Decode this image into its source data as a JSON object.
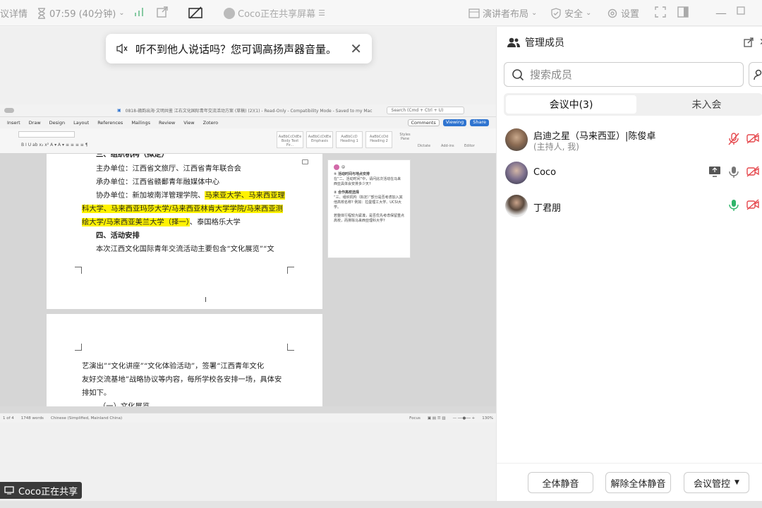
{
  "topbar": {
    "meeting_details": "议详情",
    "duration": "07:59 (40分钟)",
    "sharing_status": "Coco正在共享屏幕",
    "speaker_layout": "演讲者布局",
    "security": "安全",
    "settings": "设置"
  },
  "toast": {
    "message": "听不到他人说话吗？您可调高扬声器音量。",
    "close": "✕"
  },
  "word": {
    "filename": "0818-赣韵出海·文明共鉴 江右文化国际青年交流活动方案 (草稿) (2)(1) - Read-Only - Compatibility Mode - Saved to my Mac",
    "search": "Search (Cmd + Ctrl + U)",
    "menu": [
      "Insert",
      "Draw",
      "Design",
      "Layout",
      "References",
      "Mailings",
      "Review",
      "View",
      "Zotero"
    ],
    "comments_btn": "Comments",
    "viewing_btn": "Viewing",
    "share_btn": "Share",
    "styles": [
      "AaBbCcDdEe",
      "AaBbCcDdEe",
      "AaBbCcD",
      "AaBbCcDd"
    ],
    "style_labels": [
      "Body Text Fir...",
      "Emphasis",
      "Heading 1",
      "Heading 2"
    ],
    "ribbon_right": [
      "Styles Pane",
      "Dictate",
      "Add-ins",
      "Editor"
    ],
    "page1": {
      "heading": "三、组织机构（拟定）",
      "host": "主办单位：江西省文旅厅、江西省青年联合会",
      "organizer": "承办单位：江西省赣鄱青年融媒体中心",
      "co_prefix": "协办单位：新加坡南洋管理学院、",
      "co_hl1": "马来亚大学、马来西亚理",
      "co_hl2": "科大学、马来西亚玛莎大学/马来西亚林肯大学学院/马来西亚测",
      "co_hl3": "绘大学/马来西亚美兰大学（择一）",
      "co_end": "、泰国格乐大学",
      "section4": "四、活动安排",
      "intro": "本次江西文化国际青年交流活动主要包含“文化展览”“文"
    },
    "page2": {
      "line1": "艺演出”“文化讲座”“文化体验活动”，签署“江西青年文化",
      "line2": "友好交流基地”战略协议等内容，每所学校各安排一场，具体安",
      "line3": "排如下。",
      "line4": "（一）文化展览"
    },
    "comment": {
      "author": "@",
      "item1_title": "① 活动时间与地点安排",
      "item1_body": "在“二、活动时间”中，请问此次活动在马来西亚具体会安排多少天?",
      "item2_title": "② 合作高校选择",
      "item2_body": "“三、组织机构（拟定）”部分是否考虑加入其他高校名称? 例如：拉曼理工大学、UCSI大学。",
      "item3_body": "若整体行程较为紧凑，是否优先考虑保留重点高校，而排除马来西亚理科大学?"
    },
    "status": {
      "pages": "1 of 4",
      "words": "1748 words",
      "lang": "Chinese (Simplified, Mainland China)",
      "focus": "Focus",
      "zoom": "130%"
    }
  },
  "share_badge": "Coco正在共享",
  "panel": {
    "title": "管理成员",
    "search_placeholder": "搜索成员",
    "tab_in": "会议中(3)",
    "tab_out": "未入会",
    "members": [
      {
        "name": "启迪之星（马来西亚）|陈俊卓",
        "sub": "(主持人, 我)"
      },
      {
        "name": "Coco",
        "sub": ""
      },
      {
        "name": "丁君朋",
        "sub": ""
      }
    ],
    "mute_all": "全体静音",
    "unmute_all": "解除全体静音",
    "meeting_control": "会议管控"
  },
  "colors": {
    "highlight": "#fff200",
    "accent_blue": "#2f74d0",
    "red": "#e5484d",
    "green": "#2fb56a"
  }
}
